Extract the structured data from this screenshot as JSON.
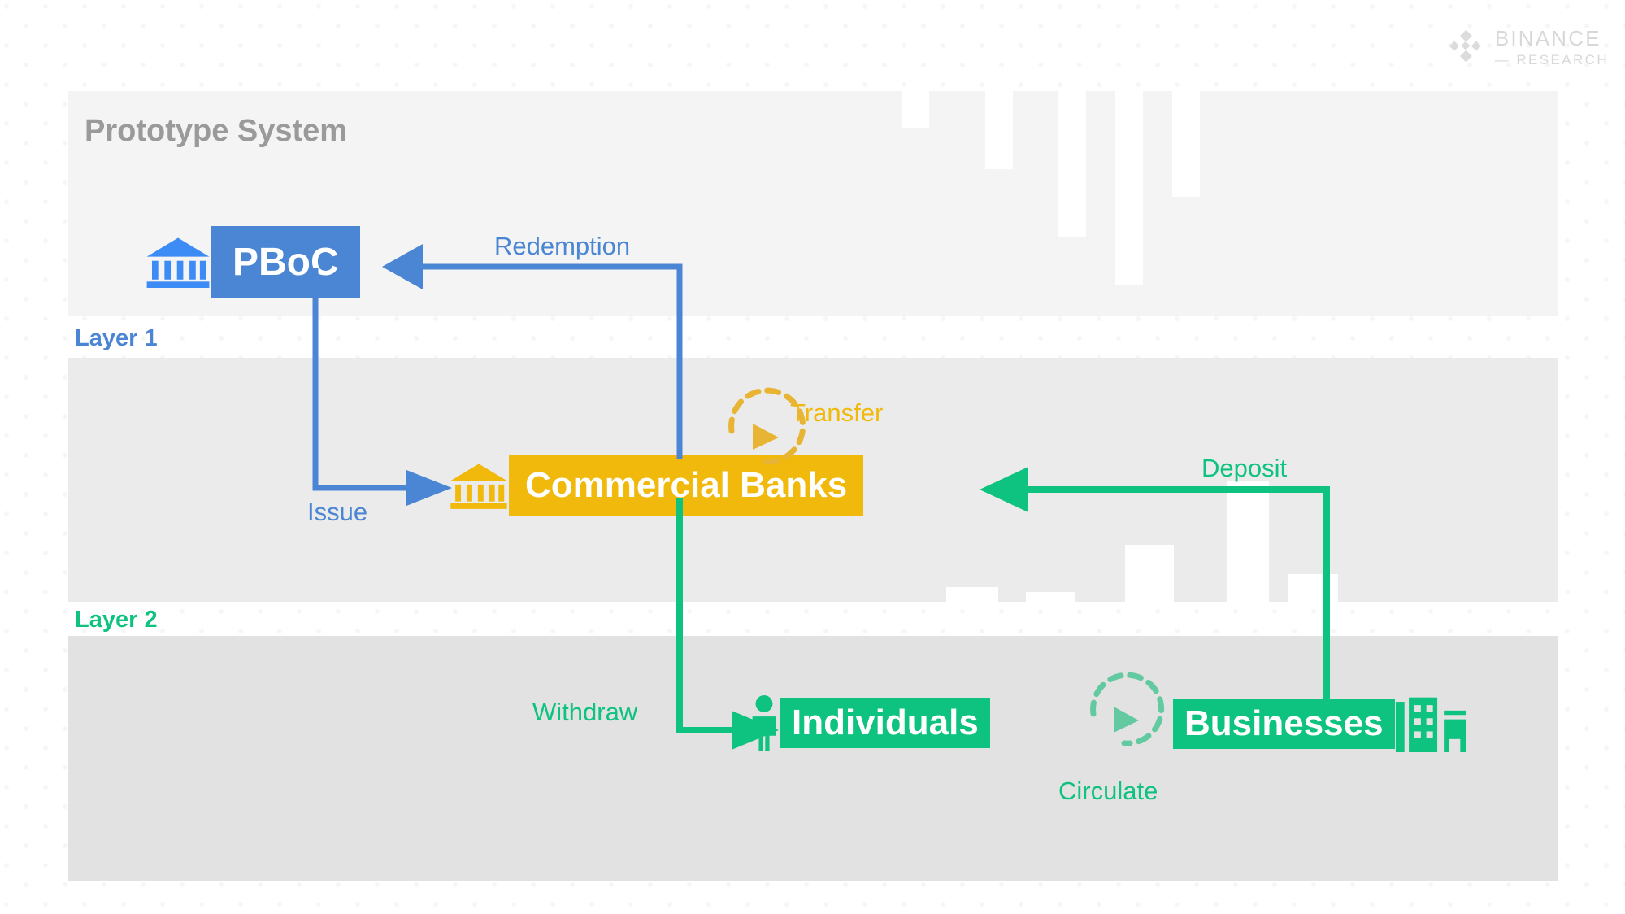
{
  "brand": {
    "name": "BINANCE",
    "sub": "— RESEARCH",
    "logo_icon": "binance-diamond-icon"
  },
  "diagram": {
    "title": "Prototype System",
    "layers": [
      {
        "id": "layer1",
        "label": "Layer 1",
        "color": "#4a86d4"
      },
      {
        "id": "layer2",
        "label": "Layer 2",
        "color": "#0ec27f"
      }
    ],
    "nodes": [
      {
        "id": "pboc",
        "label": "PBoC",
        "color": "#4a86d4",
        "icon": "bank-columns-icon",
        "layer": "layer1"
      },
      {
        "id": "commercial_banks",
        "label": "Commercial Banks",
        "color": "#f0b90b",
        "icon": "bank-columns-icon",
        "layer": "layer1"
      },
      {
        "id": "individuals",
        "label": "Individuals",
        "color": "#0ec27f",
        "icon": "person-icon",
        "layer": "layer2"
      },
      {
        "id": "businesses",
        "label": "Businesses",
        "color": "#0ec27f",
        "icon": "office-buildings-icon",
        "layer": "layer2"
      }
    ],
    "edges": [
      {
        "id": "issue",
        "label": "Issue",
        "from": "pboc",
        "to": "commercial_banks",
        "color": "#4a86d4",
        "direction": "down-right"
      },
      {
        "id": "redemption",
        "label": "Redemption",
        "from": "commercial_banks",
        "to": "pboc",
        "color": "#4a86d4",
        "direction": "up-left"
      },
      {
        "id": "transfer",
        "label": "Transfer",
        "from": "commercial_banks",
        "to": "commercial_banks",
        "color": "#f0b90b",
        "direction": "self-loop"
      },
      {
        "id": "withdraw",
        "label": "Withdraw",
        "from": "commercial_banks",
        "to": "individuals",
        "color": "#0ec27f",
        "direction": "down-right"
      },
      {
        "id": "deposit",
        "label": "Deposit",
        "from": "businesses",
        "to": "commercial_banks",
        "color": "#0ec27f",
        "direction": "up-left"
      },
      {
        "id": "circulate",
        "label": "Circulate",
        "from": "individuals",
        "to": "businesses",
        "color": "#4cc99a",
        "direction": "self-loop"
      }
    ]
  }
}
